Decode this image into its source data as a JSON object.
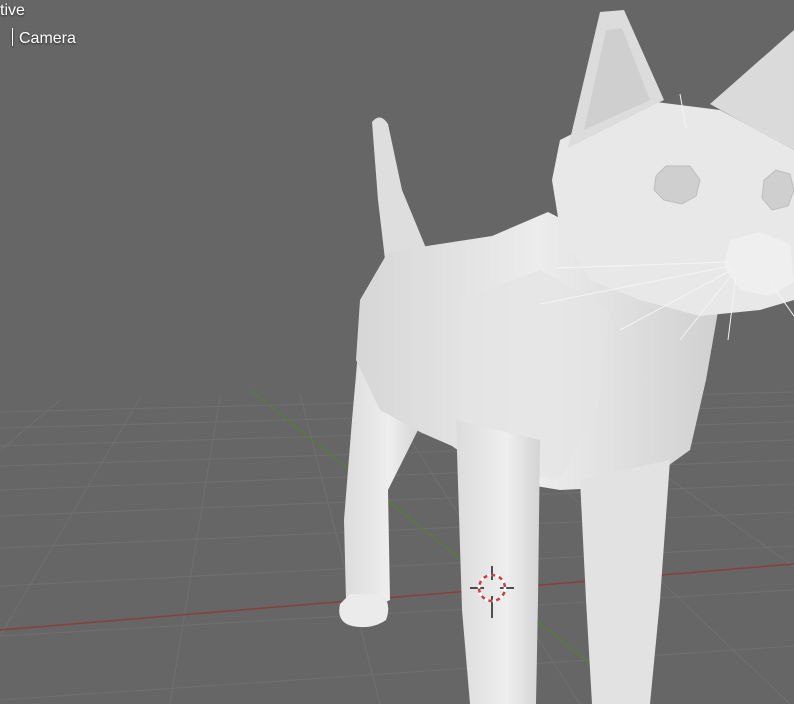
{
  "viewport": {
    "view_mode_fragment": "tive",
    "collection_fragment": "",
    "object_name": "Camera",
    "background_color": "#666666",
    "grid_color": "#707070",
    "x_axis_color": "#8a3f3f",
    "y_axis_color": "#5a7a3a",
    "model_color": "#e6e6e6"
  }
}
